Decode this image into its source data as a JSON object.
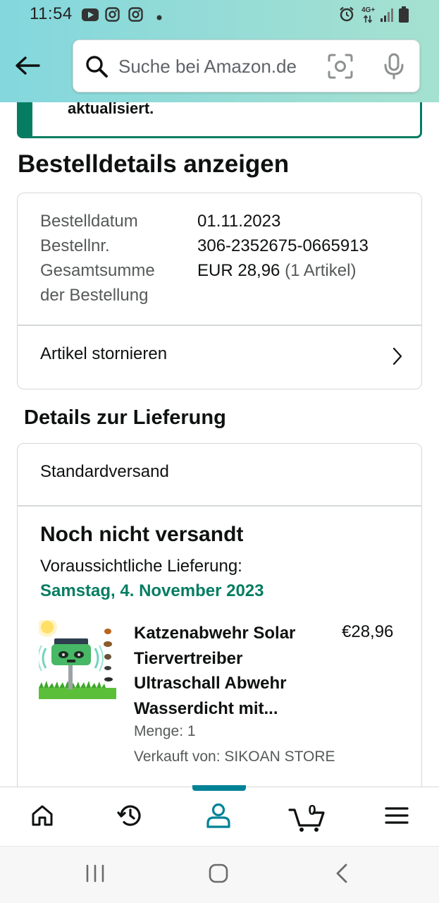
{
  "status_bar": {
    "time": "11:54",
    "network": "4G+",
    "icons": [
      "youtube-icon",
      "instagram-icon",
      "instagram-icon",
      "dot-icon",
      "alarm-icon",
      "signal-icon",
      "battery-icon"
    ]
  },
  "search": {
    "placeholder": "Suche bei Amazon.de"
  },
  "banner": {
    "text": "aktualisiert."
  },
  "page": {
    "title": "Bestelldetails anzeigen"
  },
  "order": {
    "date_label": "Bestelldatum",
    "date_value": "01.11.2023",
    "number_label": "Bestellnr.",
    "number_value": "306-2352675-0665913",
    "total_label_line1": "Gesamtsumme",
    "total_label_line2": "der Bestellung",
    "total_value": "EUR 28,96",
    "total_items": "(1 Artikel)",
    "cancel_label": "Artikel stornieren"
  },
  "delivery": {
    "heading": "Details zur Lieferung",
    "method": "Standardversand",
    "status": "Noch nicht versandt",
    "eta_label": "Voraussichtliche Lieferung:",
    "eta_date": "Samstag, 4. November 2023"
  },
  "product": {
    "title": "Katzenabwehr Solar Tiervertreiber Ultraschall Abwehr Wasserdicht mit...",
    "price": "€28,96",
    "quantity": "Menge: 1",
    "seller": "Verkauft von: SIKOAN STORE"
  },
  "bottom_nav": {
    "cart_count": "0",
    "items": [
      "home-icon",
      "history-icon",
      "account-icon",
      "cart-icon",
      "menu-icon"
    ],
    "active": "account-icon"
  },
  "colors": {
    "header_gradient_start": "#83d7dd",
    "header_gradient_end": "#a5e1d0",
    "green_accent": "#067d62",
    "teal_indicator": "#008296",
    "text_primary": "#0f1111",
    "text_secondary": "#565959",
    "border": "#d5d9d9"
  }
}
